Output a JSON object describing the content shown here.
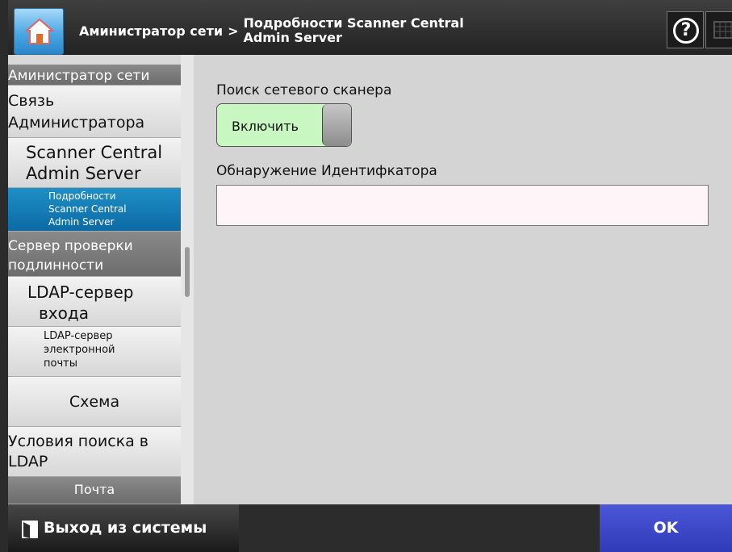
{
  "header": {
    "breadcrumb_parent": "Аминистратор сети",
    "breadcrumb_separator": ">",
    "breadcrumb_current": "Подробности Scanner Central Admin Server",
    "help_label": "?"
  },
  "sidebar": {
    "items": [
      {
        "label": "Аминистратор сети"
      },
      {
        "label": "Связь Администратора"
      },
      {
        "label": "Scanner Central Admin Server"
      },
      {
        "label": "Подробности Scanner Central Admin Server"
      },
      {
        "label": "Сервер проверки подлинности"
      },
      {
        "label": "LDAP-сервер входа"
      },
      {
        "label": "LDAP-сервер электронной почты"
      },
      {
        "label": "Схема"
      },
      {
        "label": "Условия поиска в LDAP"
      },
      {
        "label": "Почта"
      }
    ]
  },
  "main": {
    "scanner_search_label": "Поиск сетевого сканера",
    "scanner_search_toggle": "Включить",
    "discovery_id_label": "Обнаружение Идентифкатора",
    "discovery_id_value": ""
  },
  "footer": {
    "logout_label": "Выход из системы",
    "ok_label": "OK"
  },
  "colors": {
    "accent_blue": "#0c6aa4",
    "ok_button": "#3a45c8",
    "toggle_on": "#c8f7c2"
  }
}
